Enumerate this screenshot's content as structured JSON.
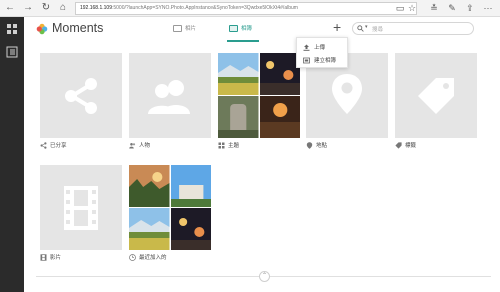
{
  "browser": {
    "url_host": "192.168.1.109",
    "url_rest": ":5000/?launchApp=SYNO.Photo.AppInstance&SynoToken=3Qwdxe5lOkXt4#/album"
  },
  "app": {
    "title": "Moments"
  },
  "tabs": [
    {
      "label": "相片",
      "active": false
    },
    {
      "label": "相簿",
      "active": true
    }
  ],
  "search": {
    "placeholder": "搜尋"
  },
  "add_menu": {
    "items": [
      {
        "label": "上傳",
        "icon": "upload-icon"
      },
      {
        "label": "建立相簿",
        "icon": "album-create-icon"
      }
    ]
  },
  "albums": [
    {
      "label": "已分享",
      "icon": "share-icon"
    },
    {
      "label": "人物",
      "icon": "people-icon"
    },
    {
      "label": "主題",
      "icon": "tag-grid-icon"
    },
    {
      "label": "地點",
      "icon": "location-icon"
    },
    {
      "label": "標籤",
      "icon": "tag-icon"
    },
    {
      "label": "影片",
      "icon": "video-icon"
    },
    {
      "label": "最近加入的",
      "icon": "clock-icon"
    }
  ],
  "colors": {
    "accent": "#2a9d8f",
    "rail": "#2b2b2b",
    "tile": "#e5e5e5"
  }
}
